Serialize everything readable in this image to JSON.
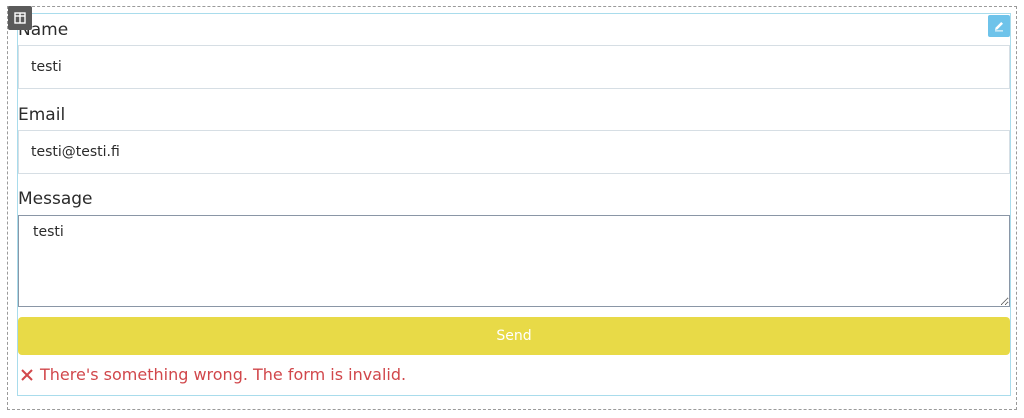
{
  "form": {
    "name_label": "Name",
    "name_value": "testi",
    "email_label": "Email",
    "email_value": "testi@testi.fi",
    "message_label": "Message",
    "message_value": "testi",
    "send_label": "Send",
    "error_message": "There's something wrong. The form is invalid."
  },
  "icons": {
    "layout": "layout-columns-icon",
    "edit": "pencil-icon",
    "error": "close-icon"
  },
  "colors": {
    "send_button": "#e8da47",
    "error_text": "#d1474b",
    "edit_badge": "#6ec3ea",
    "layout_badge": "#5b5b5b"
  }
}
